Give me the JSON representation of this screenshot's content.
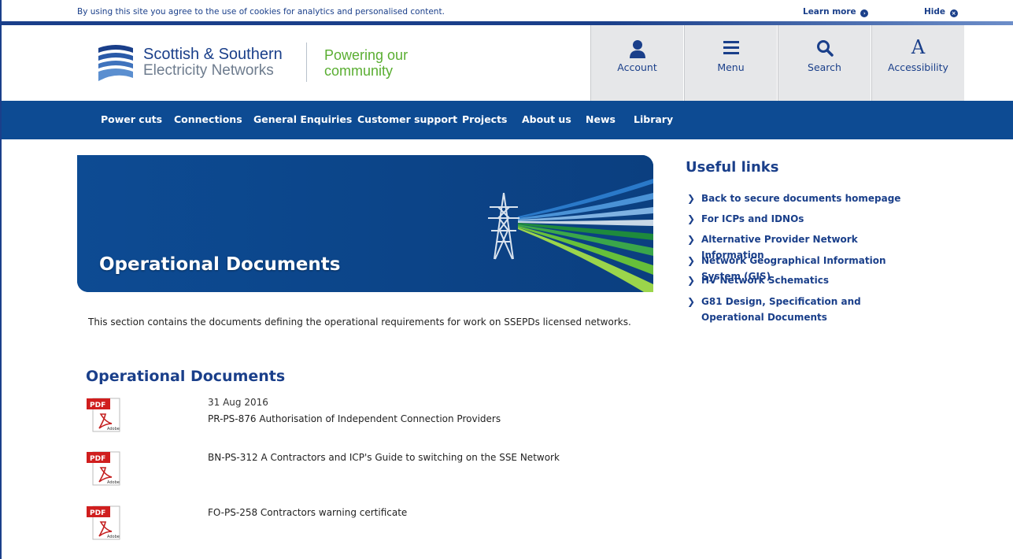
{
  "cookie_bar": {
    "message": "By using this site you agree to the use of cookies for analytics and personalised content.",
    "learn_more": "Learn more",
    "hide": "Hide"
  },
  "header": {
    "brand_line1": "Scottish & Southern",
    "brand_line2": "Electricity Networks",
    "tagline": "Powering our community",
    "utility": [
      {
        "label": "Account",
        "icon": "user-icon"
      },
      {
        "label": "Menu",
        "icon": "menu-icon"
      },
      {
        "label": "Search",
        "icon": "search-icon"
      },
      {
        "label": "Accessibility",
        "icon": "accessibility-icon"
      }
    ]
  },
  "nav": {
    "items": [
      "Power cuts",
      "Connections",
      "General Enquiries",
      "Customer support",
      "Projects",
      "About us",
      "News",
      "Library"
    ]
  },
  "banner": {
    "title": "Operational Documents"
  },
  "intro": "This section contains the documents defining the operational requirements for work on SSEPDs licensed networks.",
  "documents": {
    "title": "Operational Documents",
    "items": [
      {
        "date": "31 Aug 2016",
        "name": "PR-PS-876 Authorisation of Independent Connection Providers"
      },
      {
        "date": "",
        "name": "BN-PS-312 A Contractors and ICP's Guide to switching on the SSE Network"
      },
      {
        "date": "",
        "name": "FO-PS-258 Contractors warning certificate"
      }
    ]
  },
  "useful_links": {
    "title": "Useful links",
    "items": [
      "Back to secure documents homepage",
      "For ICPs and IDNOs",
      "Alternative Provider Network Information",
      "Network Geographical Information System (GIS)",
      "HV Network Schematics",
      "G81 Design, Specification and Operational Documents"
    ]
  },
  "colors": {
    "brand_blue": "#1a3f8a",
    "nav_blue": "#0d4b93",
    "tagline_green": "#5aae32"
  }
}
